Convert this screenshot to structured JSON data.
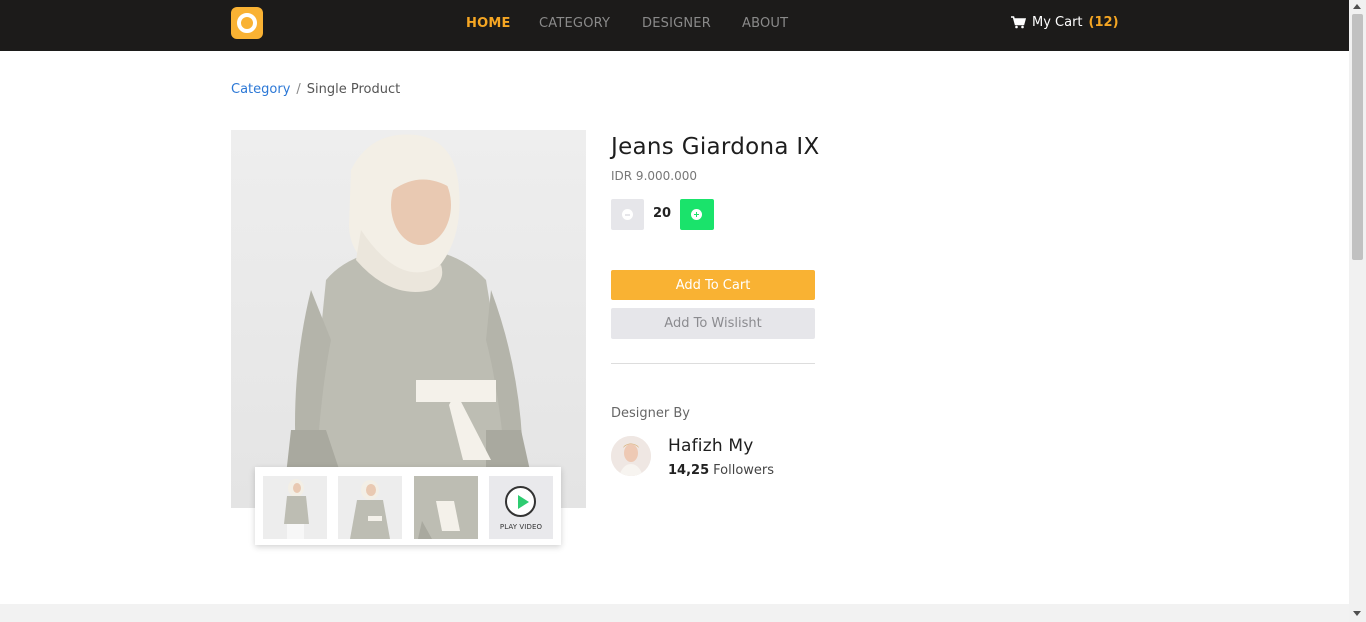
{
  "nav": {
    "items": [
      {
        "label": "HOME",
        "active": true
      },
      {
        "label": "CATEGORY",
        "active": false
      },
      {
        "label": "DESIGNER",
        "active": false
      },
      {
        "label": "ABOUT",
        "active": false
      }
    ],
    "cart_label": "My Cart",
    "cart_count": "(12)",
    "cart_icon": "shopping-cart-icon",
    "logo_icon": "ring-logo"
  },
  "breadcrumb": {
    "link": "Category",
    "separator": "/",
    "current": "Single Product"
  },
  "product": {
    "title": "Jeans Giardona IX",
    "price": "IDR 9.000.000",
    "quantity": "20",
    "add_to_cart": "Add To Cart",
    "add_to_wishlist": "Add To Wislisht"
  },
  "gallery": {
    "play_video_label": "PLAY VIDEO"
  },
  "designer": {
    "label": "Designer By",
    "name": "Hafizh My",
    "followers_count": "14,25",
    "followers_label": "Followers"
  },
  "colors": {
    "accent": "#f9b233",
    "nav_active": "#f5a623",
    "plus": "#1ae36b",
    "link": "#2c78d6",
    "topbar": "#1c1b1a"
  }
}
